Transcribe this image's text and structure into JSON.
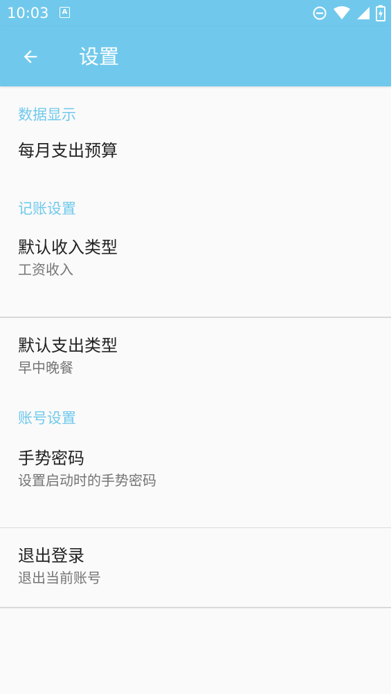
{
  "status_bar": {
    "time": "10:03",
    "notification_glyph": "A",
    "icons": [
      "dnd-icon",
      "wifi-icon",
      "signal-icon",
      "battery-charging-icon"
    ]
  },
  "app_bar": {
    "title": "设置",
    "back_icon": "arrow-back-icon"
  },
  "sections": [
    {
      "category": "数据显示",
      "items": [
        {
          "title": "每月支出预算",
          "summary": ""
        }
      ]
    },
    {
      "category": "记账设置",
      "items": [
        {
          "title": "默认收入类型",
          "summary": "工资收入"
        },
        {
          "title": "默认支出类型",
          "summary": "早中晚餐"
        }
      ]
    },
    {
      "category": "账号设置",
      "items": [
        {
          "title": "手势密码",
          "summary": "设置启动时的手势密码"
        },
        {
          "title": "退出登录",
          "summary": "退出当前账号"
        }
      ]
    }
  ],
  "colors": {
    "accent": "#70c9ec",
    "background": "#fafafa",
    "title_text": "#212121",
    "summary_text": "#757575",
    "divider": "#d9d9d9"
  }
}
